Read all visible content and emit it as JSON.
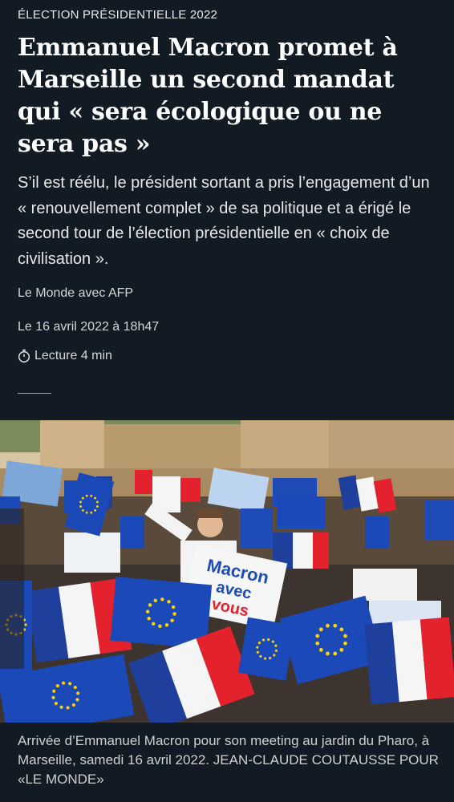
{
  "article": {
    "kicker": "Élection présidentielle 2022",
    "headline": "Emmanuel Macron promet à Marseille un second mandat qui « sera écologique ou ne sera pas »",
    "dek": "S’il est réélu, le président sortant a pris l’engagement d’un « renouvellement complet » de sa politique et a érigé le second tour de l’élection présidentielle en « choix de civilisation ».",
    "byline": "Le Monde avec AFP",
    "date": "Le 16 avril 2022 à 18h47",
    "reading_time": "Lecture 4 min",
    "reading_icon": "stopwatch-icon"
  },
  "photo": {
    "description_icon": "rally-photo",
    "sign_line1": "Macron",
    "sign_line2": "avec",
    "sign_line3": "vous",
    "colors": {
      "sky": "#d8c7a3",
      "building": "#c9ab7e",
      "flag_blue": "#1f3f9c",
      "flag_white": "#f5f5f5",
      "flag_red": "#e4222e",
      "eu_blue": "#1c49b8",
      "eu_star": "#ffd200",
      "sign_blue": "#1e4bb5"
    }
  },
  "caption": "Arrivée d’Emmanuel Macron pour son meeting au jardin du Pharo, à Marseille, samedi 16 avril 2022. JEAN-CLAUDE COUTAUSSE POUR «LE MONDE»"
}
